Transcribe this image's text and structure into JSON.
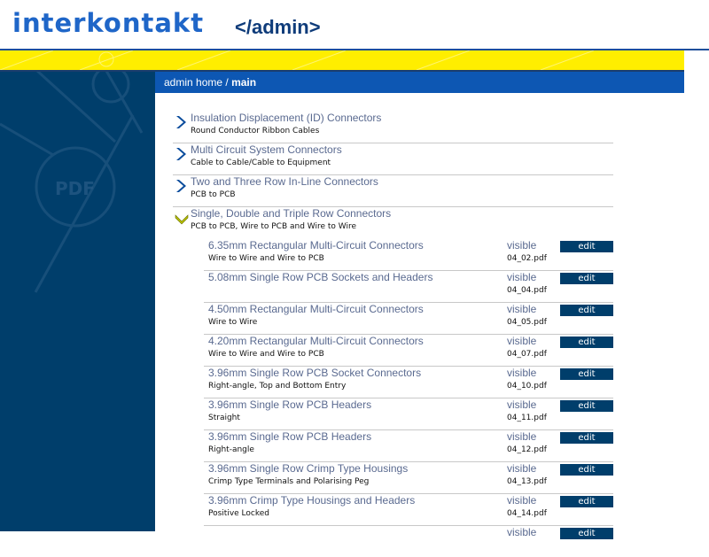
{
  "brand": {
    "logo_text": "interkontakt",
    "admin_tag": "</admin>",
    "colors": {
      "navy": "#003e6b",
      "blue": "#0d57b3",
      "yellow": "#ffee00"
    }
  },
  "breadcrumb": {
    "home": "admin home",
    "separator": " / ",
    "current": "main"
  },
  "categories": [
    {
      "title": "Insulation Displacement (ID) Connectors",
      "subtitle": "Round Conductor Ribbon Cables",
      "icon": "chevron-right-icon",
      "expanded": false
    },
    {
      "title": "Multi Circuit System Connectors",
      "subtitle": "Cable to Cable/Cable to Equipment",
      "icon": "chevron-right-icon",
      "expanded": false
    },
    {
      "title": "Two and Three Row In-Line Connectors",
      "subtitle": "PCB to PCB",
      "icon": "chevron-right-icon",
      "expanded": false
    },
    {
      "title": "Single, Double and Triple Row Connectors",
      "subtitle": "PCB to PCB, Wire to PCB and Wire to Wire",
      "icon": "chevron-down-icon",
      "expanded": true
    }
  ],
  "products": [
    {
      "title": "6.35mm Rectangular Multi-Circuit Connectors",
      "subtitle": "Wire to Wire and Wire to PCB",
      "status": "visible",
      "file": "04_02.pdf",
      "action": "edit"
    },
    {
      "title": "5.08mm Single Row PCB Sockets and Headers",
      "subtitle": "",
      "status": "visible",
      "file": "04_04.pdf",
      "action": "edit"
    },
    {
      "title": "4.50mm Rectangular Multi-Circuit Connectors",
      "subtitle": "Wire to Wire",
      "status": "visible",
      "file": "04_05.pdf",
      "action": "edit"
    },
    {
      "title": "4.20mm Rectangular Multi-Circuit Connectors",
      "subtitle": "Wire to Wire and Wire to PCB",
      "status": "visible",
      "file": "04_07.pdf",
      "action": "edit"
    },
    {
      "title": "3.96mm Single Row PCB Socket Connectors",
      "subtitle": "Right-angle, Top and Bottom Entry",
      "status": "visible",
      "file": "04_10.pdf",
      "action": "edit"
    },
    {
      "title": "3.96mm Single Row PCB Headers",
      "subtitle": "Straight",
      "status": "visible",
      "file": "04_11.pdf",
      "action": "edit"
    },
    {
      "title": "3.96mm Single Row PCB Headers",
      "subtitle": "Right-angle",
      "status": "visible",
      "file": "04_12.pdf",
      "action": "edit"
    },
    {
      "title": "3.96mm Single Row Crimp Type Housings",
      "subtitle": "Crimp Type Terminals and Polarising Peg",
      "status": "visible",
      "file": "04_13.pdf",
      "action": "edit"
    },
    {
      "title": "3.96mm Crimp Type Housings and Headers",
      "subtitle": "Positive Locked",
      "status": "visible",
      "file": "04_14.pdf",
      "action": "edit"
    },
    {
      "title": "",
      "subtitle": "",
      "status": "visible",
      "file": "",
      "action": "edit"
    }
  ],
  "sidebar": {
    "watermark_text": "PDF"
  }
}
